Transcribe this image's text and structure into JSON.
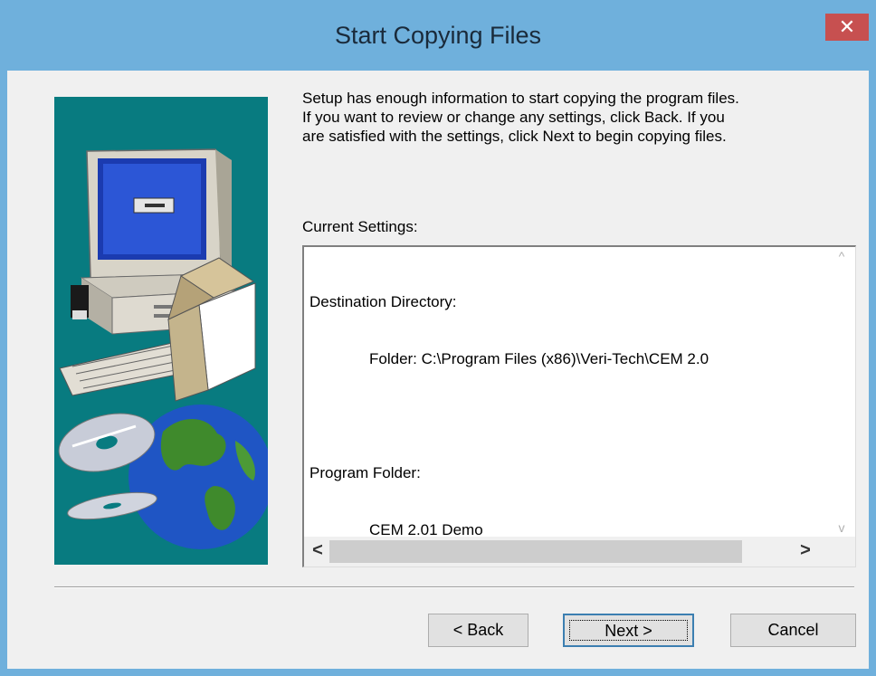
{
  "window": {
    "title": "Start Copying Files",
    "close_glyph": "✕"
  },
  "intro_text": "Setup has enough information to start copying the program files.\nIf you want to review or change any settings, click Back.  If you\nare satisfied with the settings, click Next to begin copying files.",
  "settings": {
    "label": "Current Settings:",
    "lines": [
      "Destination Directory:",
      "Folder: C:\\Program Files (x86)\\Veri-Tech\\CEM 2.0",
      "",
      "Program Folder:",
      "CEM 2.01 Demo"
    ]
  },
  "scrollbar": {
    "up": "^",
    "down": "v",
    "left": "<",
    "right": ">"
  },
  "buttons": {
    "back": "< Back",
    "next": "Next >",
    "cancel": "Cancel"
  },
  "colors": {
    "title_bar": "#6fb0dc",
    "close": "#c75050",
    "art_background": "#087b80"
  },
  "icons": [
    "computer-icon",
    "software-box-icon",
    "cd-disc-icon",
    "globe-icon",
    "close-icon"
  ]
}
